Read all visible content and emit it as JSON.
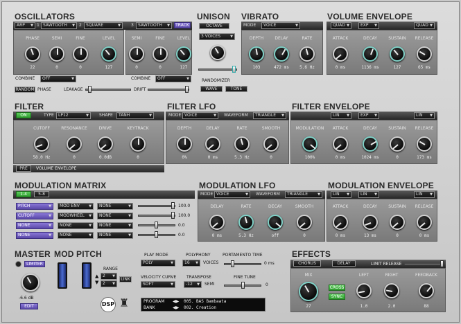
{
  "oscillators": {
    "title": "OSCILLATORS",
    "osc_a": {
      "mode": "ARP",
      "num": "1",
      "wave": "SAWTOOTH",
      "num2": "2",
      "wave2": "SQUARE"
    },
    "osc_b": {
      "num": "3",
      "wave": "SAWTOOTH",
      "track": "TRACK"
    },
    "knobs_a": [
      {
        "label": "PHASE",
        "value": "22"
      },
      {
        "label": "SEMI",
        "value": "0"
      },
      {
        "label": "FINE",
        "value": "0"
      },
      {
        "label": "LEVEL",
        "value": "127"
      }
    ],
    "knobs_b": [
      {
        "label": "SEMI",
        "value": "0"
      },
      {
        "label": "FINE",
        "value": "0"
      },
      {
        "label": "LEVEL",
        "value": "127"
      }
    ],
    "combine_label": "COMBINE",
    "combine_a": "OFF",
    "combine_b": "OFF",
    "random_phase": "RANDOM PHASE",
    "random_btn": "RANDOM",
    "phase_label": "PHASE",
    "leakage": "LEAKAGE",
    "drift": "DRIFT"
  },
  "unison": {
    "title": "UNISON",
    "octave": "OCTAVE",
    "voices": "3 VOICES",
    "randomizer": "RANDOMIZER",
    "wave_btn": "WAVE",
    "tone_btn": "TONE"
  },
  "vibrato": {
    "title": "VIBRATO",
    "mode_label": "MODE",
    "mode": "VOICE",
    "knobs": [
      {
        "label": "DEPTH",
        "value": "103"
      },
      {
        "label": "DELAY",
        "value": "472 ms"
      },
      {
        "label": "RATE",
        "value": "5.6 Hz"
      }
    ]
  },
  "volume_envelope": {
    "title": "VOLUME ENVELOPE",
    "curve1": "QUAD",
    "curve2": "EXP",
    "curve3": "QUAD",
    "knobs": [
      {
        "label": "ATTACK",
        "value": "0 ms"
      },
      {
        "label": "DECAY",
        "value": "1136 ms"
      },
      {
        "label": "SUSTAIN",
        "value": "127"
      },
      {
        "label": "RELEASE",
        "value": "65 ms"
      }
    ]
  },
  "filter": {
    "title": "FILTER",
    "on": "ON",
    "type_label": "TYPE",
    "type": "LP12",
    "shape_label": "SHAPE",
    "shape": "TANH",
    "knobs": [
      {
        "label": "CUTOFF",
        "value": "58.0 Hz"
      },
      {
        "label": "RESONANCE",
        "value": "0"
      },
      {
        "label": "DRIVE",
        "value": "0.0dB"
      },
      {
        "label": "KEYTRACK",
        "value": "0"
      }
    ],
    "pre": "PRE",
    "vol_env": "VOLUME ENVELOPE"
  },
  "filter_lfo": {
    "title": "FILTER LFO",
    "mode_label": "MODE",
    "mode": "VOICE",
    "waveform_label": "WAVEFORM",
    "waveform": "TRIANGLE",
    "knobs": [
      {
        "label": "DEPTH",
        "value": "0%"
      },
      {
        "label": "DELAY",
        "value": "0 ms"
      },
      {
        "label": "RATE",
        "value": "5.3 Hz"
      },
      {
        "label": "SMOOTH",
        "value": "0"
      }
    ]
  },
  "filter_envelope": {
    "title": "FILTER ENVELOPE",
    "curve1": "LIN",
    "curve2": "EXP",
    "curve3": "LIN",
    "knobs": [
      {
        "label": "MODULATION",
        "value": "100%"
      },
      {
        "label": "ATTACK",
        "value": "0 ms"
      },
      {
        "label": "DECAY",
        "value": "1024 ms"
      },
      {
        "label": "SUSTAIN",
        "value": "0"
      },
      {
        "label": "RELEASE",
        "value": "173 ms"
      }
    ]
  },
  "mod_matrix": {
    "title": "MODULATION MATRIX",
    "tab1": "1-4",
    "tab2": "5-8",
    "rows": [
      {
        "src": "PITCH",
        "via": "MOD ENV",
        "dst": "NONE",
        "amount": "100.0",
        "level": 1.0
      },
      {
        "src": "CUTOFF",
        "via": "MODWHEEL",
        "dst": "NONE",
        "amount": "100.0",
        "level": 1.0
      },
      {
        "src": "NONE",
        "via": "NONE",
        "dst": "NONE",
        "amount": "0.0",
        "level": 0.5
      },
      {
        "src": "NONE",
        "via": "NONE",
        "dst": "NONE",
        "amount": "0.0",
        "level": 0.5
      }
    ]
  },
  "mod_lfo": {
    "title": "MODULATION LFO",
    "mode_label": "MODE",
    "mode": "VOICE",
    "waveform_label": "WAVEFORM",
    "waveform": "TRIANGLE",
    "knobs": [
      {
        "label": "DELAY",
        "value": "0 ms"
      },
      {
        "label": "RATE",
        "value": "5.3 Hz"
      },
      {
        "label": "DECAY",
        "value": "off"
      },
      {
        "label": "SMOOTH",
        "value": "0"
      }
    ]
  },
  "mod_envelope": {
    "title": "MODULATION ENVELOPE",
    "curve1": "LIN",
    "curve2": "LIN",
    "curve3": "LIN",
    "knobs": [
      {
        "label": "ATTACK",
        "value": "0 ms"
      },
      {
        "label": "DECAY",
        "value": "13 ms"
      },
      {
        "label": "SUSTAIN",
        "value": "0"
      },
      {
        "label": "RELEASE",
        "value": "0 ms"
      }
    ]
  },
  "master": {
    "title": "MASTER",
    "limiter": "LIMITER",
    "value": "-6.6 dB",
    "edit": "EDIT",
    "mod": "MOD",
    "pitch": "PITCH",
    "range": "RANGE",
    "range_up": "2",
    "range_down": "2",
    "link": "LINK"
  },
  "play": {
    "play_mode_label": "PLAY MODE",
    "play_mode": "POLY",
    "polyphony_label": "POLYPHONY",
    "polyphony": "16",
    "voices": "VOICES",
    "portamento": "PORTAMENTO TIME",
    "portamento_val": "0 ms",
    "velocity_label": "VELOCITY CURVE",
    "velocity": "SOFT",
    "transpose_label": "TRANSPOSE",
    "transpose": "-12",
    "semi": "SEMI",
    "fine_tune": "FINE TUNE",
    "fine_val": "0",
    "dsp": "DSP",
    "program_label": "PROGRAM",
    "bank_label": "BANK",
    "program": "005. BAS Bambaata",
    "bank": "002. Creation"
  },
  "effects": {
    "title": "EFFECTS",
    "chorus": "CHORUS",
    "delay": "DELAY",
    "limit_release": "LIMIT RELEASE",
    "mix_label": "MIX",
    "mix_value": "27",
    "cross": "CROSS",
    "sync": "SYNC",
    "knobs": [
      {
        "label": "LEFT",
        "value": "1.0"
      },
      {
        "label": "RIGHT",
        "value": "2.0"
      },
      {
        "label": "FEEDBACK",
        "value": "88"
      }
    ]
  }
}
